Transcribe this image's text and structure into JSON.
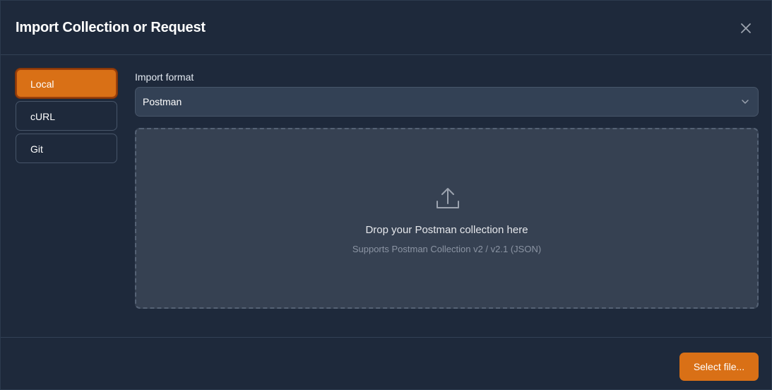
{
  "dialog": {
    "title": "Import Collection or Request",
    "close_icon": "close-icon"
  },
  "tabs": [
    {
      "label": "Local",
      "active": true
    },
    {
      "label": "cURL",
      "active": false
    },
    {
      "label": "Git",
      "active": false
    }
  ],
  "import_format": {
    "label": "Import format",
    "selected": "Postman",
    "icon": "chevron-down-icon"
  },
  "dropzone": {
    "icon": "upload-icon",
    "title": "Drop your Postman collection here",
    "subtitle": "Supports Postman Collection v2 / v2.1 (JSON)"
  },
  "footer": {
    "select_file_label": "Select file..."
  },
  "colors": {
    "accent": "#d97016",
    "background": "#1e293b",
    "input_background": "#334155"
  }
}
